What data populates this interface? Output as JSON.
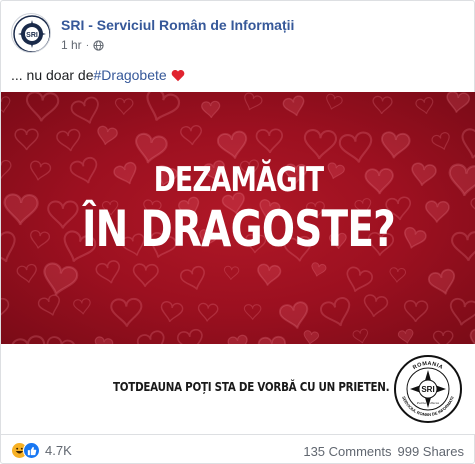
{
  "post": {
    "page_name": "SRI - Serviciul Român de Informații",
    "timestamp": "1 hr",
    "separator": "·",
    "audience_icon": "globe-icon",
    "text_prefix": "... nu doar de ",
    "hashtag": "#Dragobete",
    "emoji": "red-heart"
  },
  "image": {
    "headline_line1": "DEZAMĂGIT",
    "headline_line2": "ÎN DRAGOSTE?",
    "tagline": "TOTDEAUNA POȚI STA DE VORBĂ CU UN PRIETEN.",
    "background_color": "#a3121f",
    "logo_text_top": "ROMANIA",
    "logo_text_bottom": "SERVICIUL ROMAN DE INFORMATII",
    "logo_text_center": "SRI",
    "logo_text_motto": "Patria & Pacea"
  },
  "footer": {
    "reactions": [
      "haha",
      "like"
    ],
    "reaction_count": "4.7K",
    "comments": "135 Comments",
    "shares": "999 Shares"
  },
  "colors": {
    "link": "#365899",
    "muted": "#616770",
    "like_blue": "#1877f2",
    "haha_yellow": "#f7b125",
    "heart_red": "#e0242f"
  }
}
